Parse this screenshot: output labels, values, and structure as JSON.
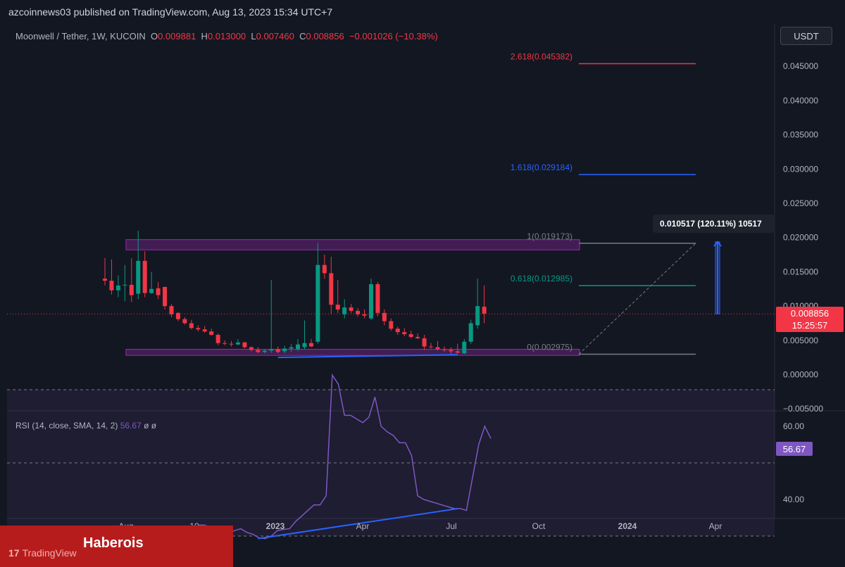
{
  "header": {
    "publisher": "azcoinnews03 published on TradingView.com, Aug 13, 2023 15:34 UTC+7",
    "symbol": "Moonwell / Tether, 1W, KUCOIN",
    "ohlc": [
      {
        "label": "O",
        "value": "0.009881"
      },
      {
        "label": "H",
        "value": "0.013000"
      },
      {
        "label": "L",
        "value": "0.007460"
      },
      {
        "label": "C",
        "value": "0.008856"
      }
    ],
    "change": "−0.001026 (−10.38%)",
    "currency": "USDT"
  },
  "chart_data": {
    "type": "candlestick",
    "symbol": "Moonwell / Tether",
    "interval": "1W",
    "exchange": "KUCOIN",
    "ylim": [
      -0.005,
      0.048
    ],
    "price_ticks": [
      "0.045000",
      "0.040000",
      "0.035000",
      "0.030000",
      "0.025000",
      "0.020000",
      "0.015000",
      "0.010000",
      "0.005000",
      "0.000000",
      "−0.005000"
    ],
    "time_ticks": [
      "Aug",
      "10",
      "2023",
      "Apr",
      "Jul",
      "Oct",
      "2024",
      "Apr"
    ],
    "current_price": "0.008856",
    "countdown": "15:25:57",
    "candles": [
      {
        "o": 0.014,
        "h": 0.017,
        "l": 0.013,
        "c": 0.0137
      },
      {
        "o": 0.0137,
        "h": 0.0168,
        "l": 0.0117,
        "c": 0.0123
      },
      {
        "o": 0.0123,
        "h": 0.0145,
        "l": 0.0113,
        "c": 0.013
      },
      {
        "o": 0.013,
        "h": 0.016,
        "l": 0.0107,
        "c": 0.0131
      },
      {
        "o": 0.0131,
        "h": 0.017,
        "l": 0.0106,
        "c": 0.0116
      },
      {
        "o": 0.0118,
        "h": 0.021,
        "l": 0.011,
        "c": 0.0166
      },
      {
        "o": 0.0166,
        "h": 0.018,
        "l": 0.0113,
        "c": 0.0119
      },
      {
        "o": 0.0119,
        "h": 0.015,
        "l": 0.0118,
        "c": 0.0125
      },
      {
        "o": 0.0126,
        "h": 0.0135,
        "l": 0.011,
        "c": 0.0116
      },
      {
        "o": 0.0128,
        "h": 0.0128,
        "l": 0.0095,
        "c": 0.01
      },
      {
        "o": 0.01,
        "h": 0.0103,
        "l": 0.0084,
        "c": 0.0088
      },
      {
        "o": 0.009,
        "h": 0.0091,
        "l": 0.0078,
        "c": 0.0081
      },
      {
        "o": 0.0081,
        "h": 0.0084,
        "l": 0.0073,
        "c": 0.0075
      },
      {
        "o": 0.0075,
        "h": 0.008,
        "l": 0.0066,
        "c": 0.0068
      },
      {
        "o": 0.0068,
        "h": 0.0072,
        "l": 0.0063,
        "c": 0.0066
      },
      {
        "o": 0.0066,
        "h": 0.0071,
        "l": 0.0061,
        "c": 0.0063
      },
      {
        "o": 0.0063,
        "h": 0.0067,
        "l": 0.0057,
        "c": 0.0058
      },
      {
        "o": 0.0058,
        "h": 0.006,
        "l": 0.0043,
        "c": 0.0046
      },
      {
        "o": 0.0046,
        "h": 0.005,
        "l": 0.0043,
        "c": 0.0045
      },
      {
        "o": 0.0045,
        "h": 0.0049,
        "l": 0.0041,
        "c": 0.0044
      },
      {
        "o": 0.0044,
        "h": 0.0052,
        "l": 0.0043,
        "c": 0.0047
      },
      {
        "o": 0.0047,
        "h": 0.0048,
        "l": 0.0038,
        "c": 0.004
      },
      {
        "o": 0.004,
        "h": 0.0041,
        "l": 0.0034,
        "c": 0.0036
      },
      {
        "o": 0.0036,
        "h": 0.004,
        "l": 0.0031,
        "c": 0.0033
      },
      {
        "o": 0.0033,
        "h": 0.0037,
        "l": 0.0031,
        "c": 0.0035
      },
      {
        "o": 0.0035,
        "h": 0.0138,
        "l": 0.0032,
        "c": 0.0037
      },
      {
        "o": 0.0037,
        "h": 0.0041,
        "l": 0.0031,
        "c": 0.0033
      },
      {
        "o": 0.0034,
        "h": 0.0042,
        "l": 0.0031,
        "c": 0.0038
      },
      {
        "o": 0.0038,
        "h": 0.0045,
        "l": 0.0033,
        "c": 0.004
      },
      {
        "o": 0.0037,
        "h": 0.0052,
        "l": 0.0034,
        "c": 0.0044
      },
      {
        "o": 0.004,
        "h": 0.0079,
        "l": 0.0037,
        "c": 0.0046
      },
      {
        "o": 0.0046,
        "h": 0.0052,
        "l": 0.004,
        "c": 0.0041
      },
      {
        "o": 0.0048,
        "h": 0.0192,
        "l": 0.0045,
        "c": 0.016
      },
      {
        "o": 0.016,
        "h": 0.0175,
        "l": 0.014,
        "c": 0.0148
      },
      {
        "o": 0.0148,
        "h": 0.0172,
        "l": 0.0088,
        "c": 0.0102
      },
      {
        "o": 0.0102,
        "h": 0.0138,
        "l": 0.009,
        "c": 0.0095
      },
      {
        "o": 0.0088,
        "h": 0.011,
        "l": 0.0082,
        "c": 0.0098
      },
      {
        "o": 0.0098,
        "h": 0.0103,
        "l": 0.009,
        "c": 0.0093
      },
      {
        "o": 0.0093,
        "h": 0.0097,
        "l": 0.0085,
        "c": 0.0088
      },
      {
        "o": 0.0088,
        "h": 0.0095,
        "l": 0.0082,
        "c": 0.0086
      },
      {
        "o": 0.0082,
        "h": 0.014,
        "l": 0.008,
        "c": 0.0132
      },
      {
        "o": 0.0132,
        "h": 0.0135,
        "l": 0.0085,
        "c": 0.009
      },
      {
        "o": 0.009,
        "h": 0.0095,
        "l": 0.0072,
        "c": 0.0078
      },
      {
        "o": 0.0078,
        "h": 0.0082,
        "l": 0.0064,
        "c": 0.0067
      },
      {
        "o": 0.0067,
        "h": 0.007,
        "l": 0.0058,
        "c": 0.0062
      },
      {
        "o": 0.0062,
        "h": 0.0068,
        "l": 0.0056,
        "c": 0.0059
      },
      {
        "o": 0.0059,
        "h": 0.0064,
        "l": 0.0053,
        "c": 0.0055
      },
      {
        "o": 0.0055,
        "h": 0.006,
        "l": 0.0052,
        "c": 0.0053
      },
      {
        "o": 0.0053,
        "h": 0.0058,
        "l": 0.0036,
        "c": 0.0041
      },
      {
        "o": 0.0041,
        "h": 0.0046,
        "l": 0.0038,
        "c": 0.004
      },
      {
        "o": 0.004,
        "h": 0.0049,
        "l": 0.0035,
        "c": 0.0037
      },
      {
        "o": 0.0037,
        "h": 0.0041,
        "l": 0.0033,
        "c": 0.0036
      },
      {
        "o": 0.0036,
        "h": 0.004,
        "l": 0.003,
        "c": 0.0034
      },
      {
        "o": 0.0034,
        "h": 0.0045,
        "l": 0.003,
        "c": 0.0032
      },
      {
        "o": 0.0031,
        "h": 0.0052,
        "l": 0.003,
        "c": 0.0048
      },
      {
        "o": 0.0048,
        "h": 0.008,
        "l": 0.0045,
        "c": 0.0075
      },
      {
        "o": 0.0072,
        "h": 0.014,
        "l": 0.0067,
        "c": 0.01
      },
      {
        "o": 0.0099,
        "h": 0.013,
        "l": 0.0075,
        "c": 0.0089
      }
    ],
    "fib_levels": [
      {
        "label": "2.618(0.045382)",
        "value": 0.045382,
        "color": "#f23645"
      },
      {
        "label": "1.618(0.029184)",
        "value": 0.029184,
        "color": "#2962ff"
      },
      {
        "label": "1(0.019173)",
        "value": 0.019173,
        "color": "#787b86"
      },
      {
        "label": "0.618(0.012985)",
        "value": 0.012985,
        "color": "#089981"
      },
      {
        "label": "0(0.002975)",
        "value": 0.002975,
        "color": "#787b86"
      }
    ],
    "zones": [
      {
        "top": 0.0197,
        "bottom": 0.0182
      },
      {
        "top": 0.0037,
        "bottom": 0.0028
      }
    ],
    "measure": {
      "from": 0.008856,
      "to": 0.019373,
      "label": "0.010517 (120.11%) 10517"
    },
    "trendline": {
      "from": 0.0025,
      "to": 0.0029
    },
    "colors": {
      "up": "#089981",
      "down": "#f23645",
      "rsi": "#7e57c2",
      "divergence": "#2962ff",
      "zone": "#9c27b0"
    }
  },
  "rsi": {
    "label": "RSI (14, close, SMA, 14, 2)",
    "value": "56.67",
    "extra": "ø ø",
    "ticks": [
      "60.00",
      "40.00"
    ],
    "ylim": [
      25,
      75
    ],
    "values": [
      33,
      33,
      32.5,
      31,
      30.5,
      30.8,
      31.5,
      32,
      31,
      30.5,
      29.5,
      29.3,
      30,
      31.5,
      31.8,
      32,
      34,
      35.5,
      37,
      38.5,
      38.5,
      41,
      74,
      71.5,
      63,
      63,
      62,
      61,
      62.5,
      68,
      60,
      58.5,
      57.5,
      55.5,
      55.5,
      52,
      41,
      40,
      39.5,
      39,
      38.5,
      38,
      37.5,
      37.5,
      37,
      46,
      55,
      60,
      56.67
    ],
    "divergence": [
      29.3,
      37.5
    ]
  },
  "banner": {
    "title": "Haberois",
    "logo_text": "TradingView",
    "logo_mark": "17"
  }
}
